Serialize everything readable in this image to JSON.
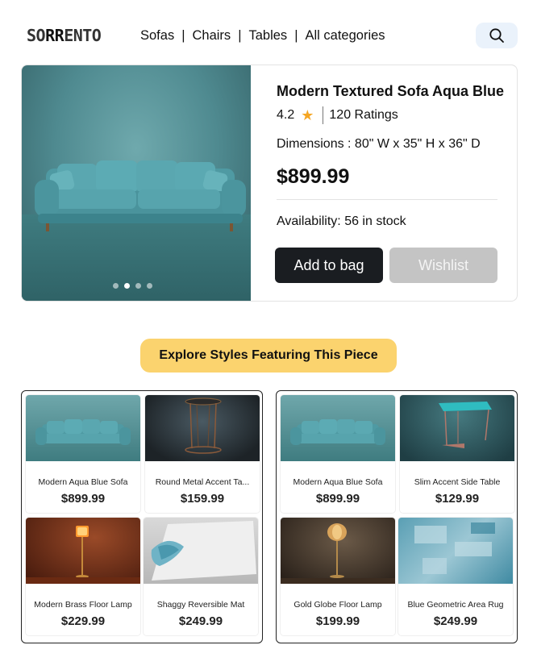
{
  "header": {
    "logo_part1": "SO",
    "logo_part2": "RR",
    "logo_part3": "ENTO",
    "nav": [
      "Sofas",
      "Chairs",
      "Tables",
      "All categories"
    ],
    "separator": "|",
    "search_icon": "search-icon"
  },
  "product": {
    "title": "Modern Textured Sofa Aqua Blue",
    "rating": "4.2",
    "rating_icon": "star-icon",
    "ratings_count": "120 Ratings",
    "dimensions": "Dimensions : 80\" W x 35\" H x 36\" D",
    "price": "$899.99",
    "availability": "Availability: 56 in stock",
    "add_label": "Add to bag",
    "wishlist_label": "Wishlist",
    "carousel_active_index": 1,
    "carousel_count": 4
  },
  "explore_label": "Explore Styles Featuring This Piece",
  "groups": [
    {
      "items": [
        {
          "name": "Modern Aqua Blue Sofa",
          "price": "$899.99"
        },
        {
          "name": "Round Metal Accent Ta...",
          "price": "$159.99"
        },
        {
          "name": "Modern Brass Floor Lamp",
          "price": "$229.99"
        },
        {
          "name": "Shaggy Reversible Mat",
          "price": "$249.99"
        }
      ]
    },
    {
      "items": [
        {
          "name": "Modern Aqua Blue Sofa",
          "price": "$899.99"
        },
        {
          "name": "Slim Accent Side Table",
          "price": "$129.99"
        },
        {
          "name": "Gold Globe Floor Lamp",
          "price": "$199.99"
        },
        {
          "name": "Blue Geometric Area Rug",
          "price": "$249.99"
        }
      ]
    }
  ],
  "colors": {
    "accent_yellow": "#fbd36e",
    "button_dark": "#1a1d21",
    "button_disabled": "#c4c4c4",
    "star": "#f5a623",
    "search_bg": "#eaf2fb"
  }
}
